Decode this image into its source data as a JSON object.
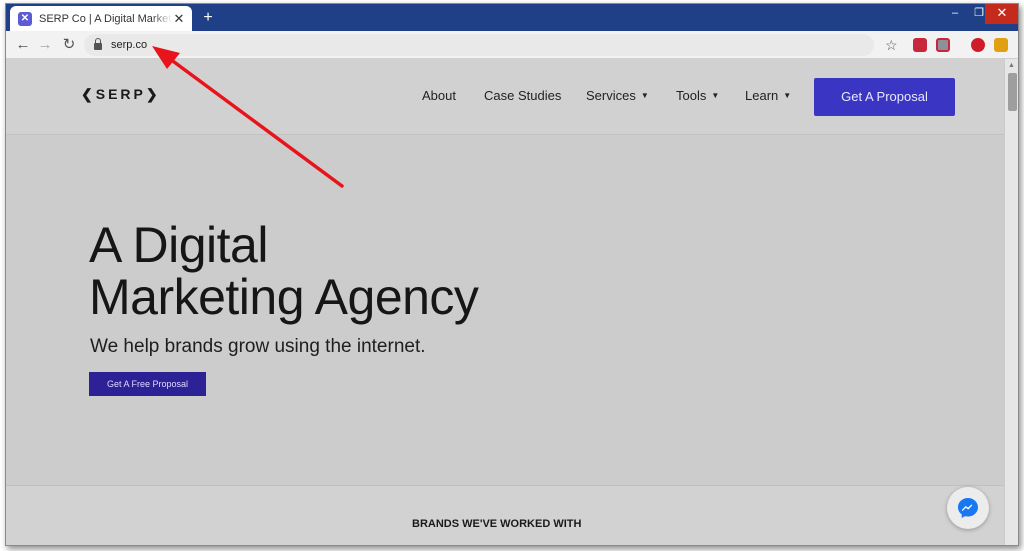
{
  "browser": {
    "tab_title": "SERP Co | A Digital Marketing Agency",
    "favicon_letter": "✕",
    "tab_close": "✕",
    "new_tab": "+",
    "url": "serp.co",
    "window_controls": {
      "minimize": "–",
      "maximize": "❐",
      "close": "✕"
    },
    "icons": {
      "back": "←",
      "forward": "→",
      "reload": "↻",
      "bookmark": "☆"
    }
  },
  "site": {
    "logo": "❮SERP❯",
    "nav": [
      {
        "label": "About"
      },
      {
        "label": "Case Studies"
      },
      {
        "label": "Services",
        "dropdown": true
      },
      {
        "label": "Tools",
        "dropdown": true
      },
      {
        "label": "Learn",
        "dropdown": true
      }
    ],
    "caret": "▼",
    "cta": "Get A Proposal",
    "hero": {
      "title_line1": "A Digital",
      "title_line2": "Marketing Agency",
      "subtitle": "We help brands grow using the internet.",
      "button": "Get A Free Proposal"
    },
    "brands_heading": "BRANDS WE'VE WORKED WITH",
    "messenger_icon": "messenger-icon"
  },
  "colors": {
    "tabstrip": "#1f3f87",
    "cta": "#3b35c4",
    "hero_button": "#2c2296",
    "annotation": "#e8141b"
  }
}
